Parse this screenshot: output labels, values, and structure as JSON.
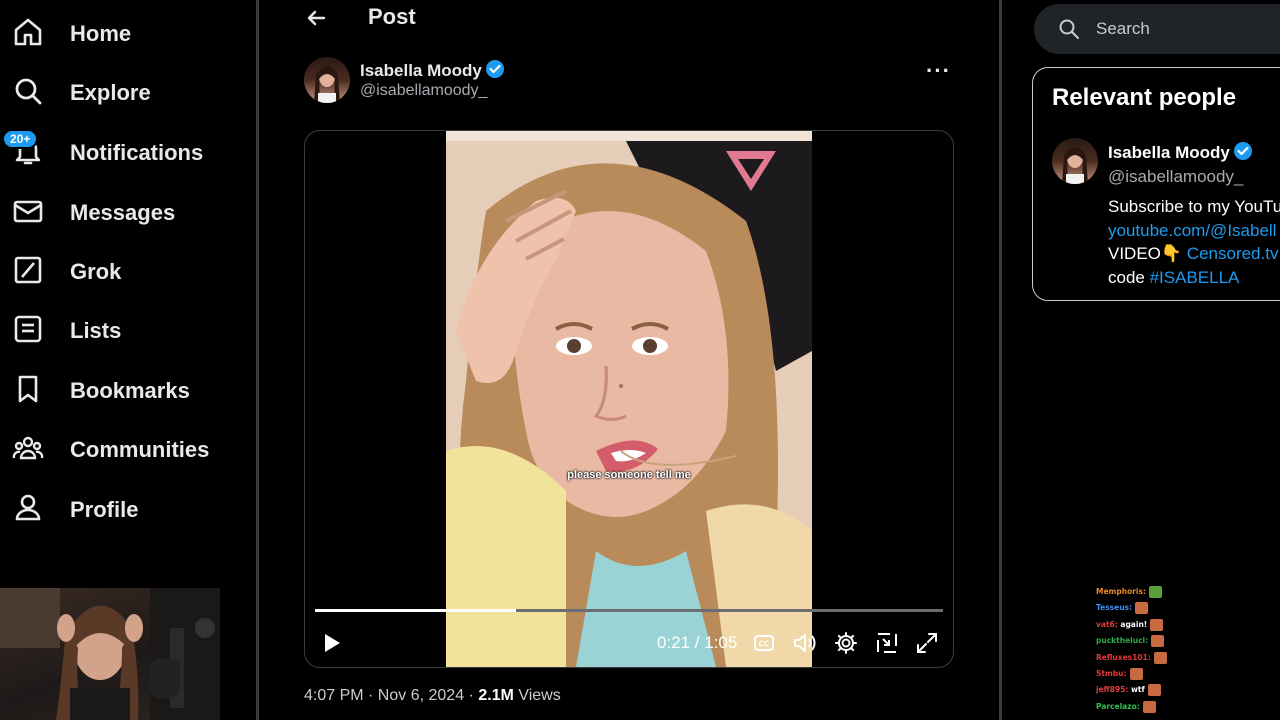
{
  "nav": {
    "items": [
      {
        "label": "Home"
      },
      {
        "label": "Explore"
      },
      {
        "label": "Notifications",
        "badge": "20+"
      },
      {
        "label": "Messages"
      },
      {
        "label": "Grok"
      },
      {
        "label": "Lists"
      },
      {
        "label": "Bookmarks"
      },
      {
        "label": "Communities"
      },
      {
        "label": "Profile"
      }
    ]
  },
  "header": {
    "title": "Post"
  },
  "post": {
    "author_name": "Isabella Moody",
    "author_handle": "@isabellamoody_",
    "video": {
      "caption": "please someone tell me",
      "time": "0:21 / 1:05",
      "progress": 0.32
    },
    "timestamp": "4:07 PM · Nov 6, 2024 · ",
    "views_count": "2.1M",
    "views_label": " Views"
  },
  "search": {
    "placeholder": "Search"
  },
  "relevant": {
    "title": "Relevant people",
    "name": "Isabella Moody",
    "handle": "@isabellamoody_",
    "bio_line1": "Subscribe to my YouTu",
    "bio_link1": "youtube.com/@Isabell",
    "bio_line3_text": "VIDEO👇 ",
    "bio_link2": "Censored.tv",
    "bio_line4_text": "code ",
    "bio_hashtag": "#ISABELLA"
  },
  "chat": [
    {
      "user": "Memphoris:",
      "msg": "",
      "color": "#e8862a"
    },
    {
      "user": "Tesseus:",
      "msg": "",
      "color": "#3a8cf0"
    },
    {
      "user": "vat6:",
      "msg": " again!",
      "color": "#e03a3a"
    },
    {
      "user": "puckthelucl:",
      "msg": "",
      "color": "#2ea84a"
    },
    {
      "user": "Refluxes101:",
      "msg": "",
      "color": "#e03a3a"
    },
    {
      "user": "Stmbu:",
      "msg": "",
      "color": "#e03a3a"
    },
    {
      "user": "jeff895:",
      "msg": " wtf",
      "color": "#e03a3a"
    },
    {
      "user": "Parcelazo:",
      "msg": "",
      "color": "#2ec24a"
    }
  ],
  "colors": {
    "accent": "#1d9bf0",
    "background": "#000000",
    "text": "#e7e9ea",
    "muted": "#a6abb0"
  },
  "icons": [
    "home-icon",
    "search-icon",
    "bell-icon",
    "mail-icon",
    "grok-icon",
    "list-icon",
    "bookmark-icon",
    "communities-icon",
    "person-icon",
    "back-arrow-icon",
    "verified-badge-icon",
    "more-icon",
    "play-icon",
    "cc-icon",
    "volume-icon",
    "settings-icon",
    "pip-icon",
    "fullscreen-icon"
  ]
}
